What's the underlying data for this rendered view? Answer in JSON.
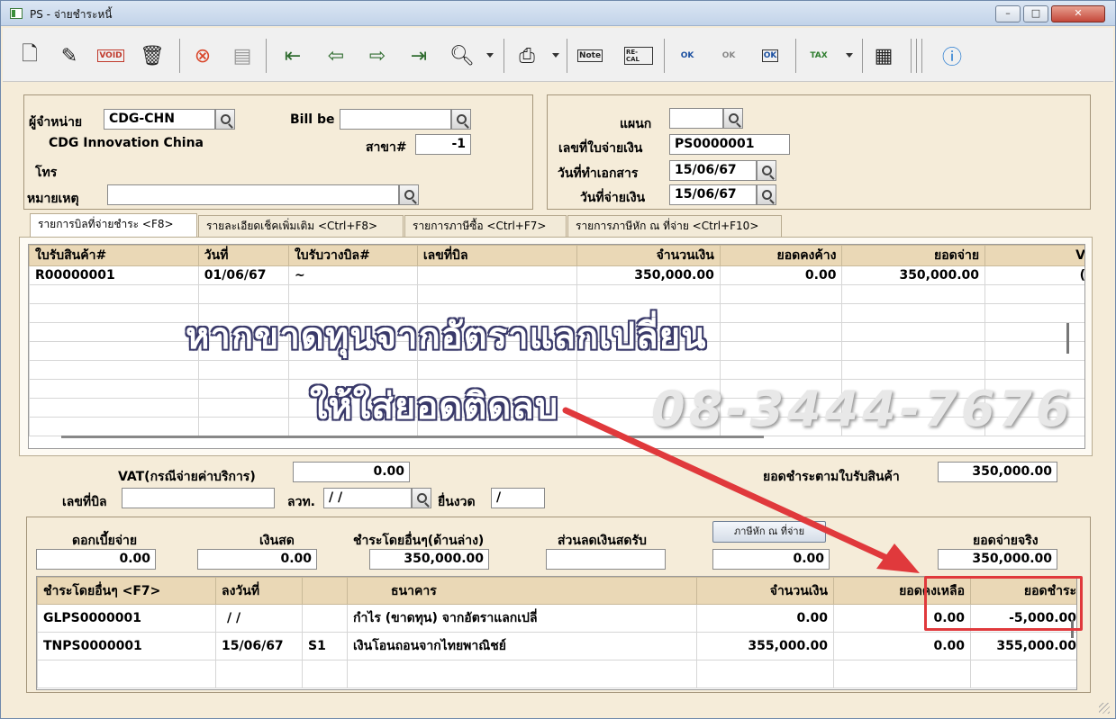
{
  "window": {
    "title": "PS - จ่ายชำระหนี้",
    "minimize": "–",
    "maximize": "□",
    "close": "✕"
  },
  "toolbar": {
    "buttons": [
      "new-icon",
      "edit-icon",
      "void-icon",
      "delete-icon",
      "cancel-icon",
      "save-icon",
      "first-record-icon",
      "previous-record-icon",
      "next-record-icon",
      "last-record-icon",
      "search-icon",
      "print-icon",
      "note-icon",
      "recalc-icon",
      "approve-ok-icon",
      "unapprove-icon",
      "attach-ok-icon",
      "print-tax-icon",
      "report-icon",
      "help-icon"
    ],
    "note_label": "Note",
    "recalc_label": "RE-CAL",
    "ok_label": "OK",
    "void_label": "VOID",
    "tax_label": "TAX"
  },
  "header_left": {
    "vendor_label": "ผู้จำหน่าย",
    "vendor_code": "CDG-CHN",
    "vendor_name": "CDG Innovation China",
    "phone_label": "โทร",
    "remark_label": "หมายเหตุ",
    "remark_value": "",
    "bill_label": "Bill be",
    "bill_value": "",
    "branch_label": "สาขา#",
    "branch_value": "-1"
  },
  "header_right": {
    "department_label": "แผนก",
    "department_value": "",
    "payment_no_label": "เลขที่ใบจ่ายเงิน",
    "payment_no_value": "PS0000001",
    "doc_date_label": "วันที่ทำเอกสาร",
    "doc_date_value": "15/06/67",
    "pay_date_label": "วันที่จ่ายเงิน",
    "pay_date_value": "15/06/67"
  },
  "tabs": [
    {
      "label": "รายการบิลที่จ่ายชำระ <F8>",
      "active": true
    },
    {
      "label": "รายละเอียดเช็คเพิ่มเติม  <Ctrl+F8>",
      "active": false
    },
    {
      "label": "รายการภาษีซื้อ <Ctrl+F7>",
      "active": false
    },
    {
      "label": "รายการภาษีหัก ณ ที่จ่าย <Ctrl+F10>",
      "active": false
    }
  ],
  "bill_grid": {
    "columns": [
      "ใบรับสินค้า#",
      "วันที่",
      "ใบรับวางบิล#",
      "เลขที่บิล",
      "จำนวนเงิน",
      "ยอดคงค้าง",
      "ยอดจ่าย",
      "V"
    ],
    "rows": [
      [
        "R00000001",
        "01/06/67",
        "~",
        "",
        "350,000.00",
        "0.00",
        "350,000.00",
        "("
      ]
    ]
  },
  "annotation": {
    "line1": "หากขาดทุนจากอัตราแลกเปลี่ยน",
    "line2": "ให้ใส่ยอดติดลบ",
    "phone": "08-3444-7676"
  },
  "middle": {
    "vat_label": "VAT(กรณีจ่ายค่าบริการ)",
    "vat_value": "0.00",
    "bill_no_label": "เลขที่บิล",
    "bill_no_value": "",
    "tax_date_label": "ลวท.",
    "tax_date_value": " /  /",
    "filing_label": "ยื่นงวด",
    "filing_value": "  /",
    "total_by_receipt_label": "ยอดชำระตามใบรับสินค้า",
    "total_by_receipt_value": "350,000.00"
  },
  "payment": {
    "interest_label": "ดอกเบี้ยจ่าย",
    "interest_value": "0.00",
    "cash_label": "เงินสด",
    "cash_value": "0.00",
    "other_label": "ชำระโดยอื่นๆ(ด้านล่าง)",
    "other_value": "350,000.00",
    "discount_label": "ส่วนลดเงินสดรับ",
    "discount_value": "",
    "wht_button": "ภาษีหัก ณ ที่จ่าย",
    "wht_value": "0.00",
    "actual_label": "ยอดจ่ายจริง",
    "actual_value": "350,000.00"
  },
  "pay_grid": {
    "columns": [
      "ชำระโดยอื่นๆ <F7>",
      "ลงวันที่",
      "",
      "ธนาคาร",
      "จำนวนเงิน",
      "ยอดคงเหลือ",
      "ยอดชำระ"
    ],
    "rows": [
      [
        "GLPS0000001",
        " /  /",
        "",
        "กำไร (ขาดทุน) จากอัตราแลกเปลี่",
        "0.00",
        "0.00",
        "-5,000.00"
      ],
      [
        "TNPS0000001",
        "15/06/67",
        "S1",
        "เงินโอนถอนจากไทยพาณิชย์",
        "355,000.00",
        "0.00",
        "355,000.00"
      ]
    ]
  },
  "colors": {
    "panel": "#f5ecd9",
    "grid_header": "#ead8b6",
    "highlight": "#e0393c"
  }
}
